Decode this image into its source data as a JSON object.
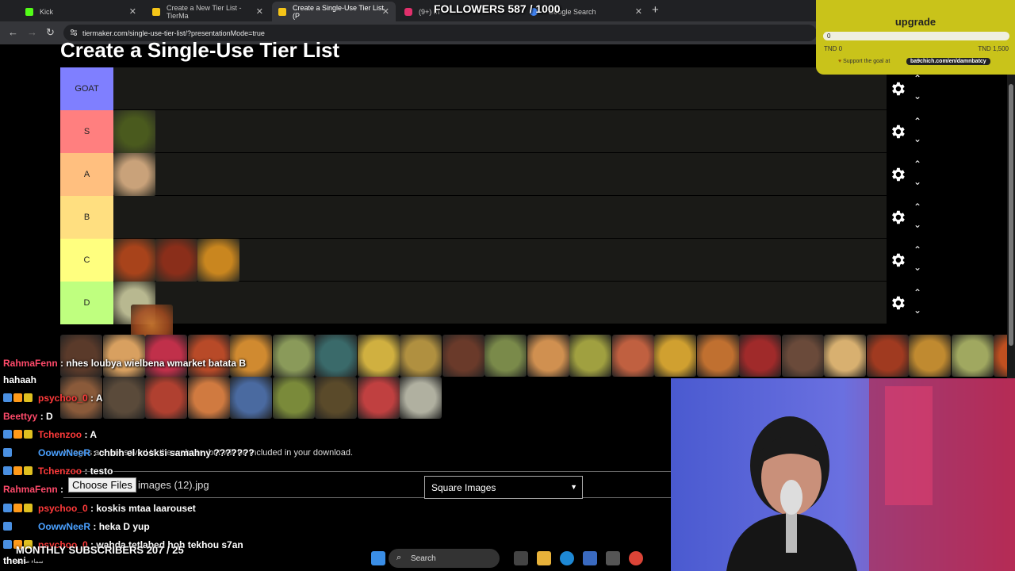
{
  "browser": {
    "tabs": [
      {
        "label": "Kick",
        "color": "#53fc18"
      },
      {
        "label": "Create a New Tier List - TierMa",
        "color": "#f5c518"
      },
      {
        "label": "Create a Single-Use Tier List (P",
        "color": "#f5c518"
      },
      {
        "label": "(9+) In",
        "color": "#e1306c"
      },
      {
        "label": "- Google Search",
        "color": "#4285f4"
      }
    ],
    "url": "tiermaker.com/single-use-tier-list/?presentationMode=true"
  },
  "page": {
    "title": "Create a Single-Use Tier List",
    "tiers": [
      {
        "label": "GOAT",
        "color": "#7f7fff",
        "items": []
      },
      {
        "label": "S",
        "color": "#ff7f7f",
        "items": [
          "#4a5a1e"
        ]
      },
      {
        "label": "A",
        "color": "#ffbf7f",
        "items": [
          "#c9a27a"
        ]
      },
      {
        "label": "B",
        "color": "#ffdf80",
        "items": []
      },
      {
        "label": "C",
        "color": "#ffff7f",
        "items": [
          "#a8431b",
          "#8a2e1a",
          "#c9861f"
        ]
      },
      {
        "label": "D",
        "color": "#bfff7f",
        "items": [
          "#b8b890"
        ]
      }
    ],
    "pool_row1": [
      "#5a3a2a",
      "#d8a060",
      "#c0304a",
      "#b84a28",
      "#d08a30",
      "#8a9a5a",
      "#3a6a6a",
      "#d0b040",
      "#b09040",
      "#6a3a2a",
      "#7a8a4a",
      "#d09050",
      "#a0a040",
      "#c06040",
      "#d0a030",
      "#c07030",
      "#a02a2a",
      "#6a4a3a",
      "#d8b070",
      "#a03a20",
      "#c08a30",
      "#a0a860",
      "#c05020"
    ],
    "pool_row2": [
      "#8a5a3a",
      "#5a4a3a",
      "#b04030",
      "#d07a40",
      "#4a6aa0",
      "#7a8a3a",
      "#5a4a2a",
      "#c04040",
      "#b0b0a0"
    ],
    "info_text": "Images are not saved to the website, but will be included in your download.",
    "choose_files": "Choose Files",
    "file_name": "images (12).jpg",
    "image_shape": "Square Images"
  },
  "overlay": {
    "followers": "FOLLOWERS 587 / 1000",
    "upgrade_title": "upgrade",
    "goal_value": "0",
    "goal_low": "TND 0",
    "goal_high": "TND 1,500",
    "support_text": "Support the goal at",
    "support_link": "ba9chich.com/en/damnbatcy",
    "subs": "MONTHLY SUBSCRIBERS 207 / 25",
    "subs_small": "سماء صافية"
  },
  "chat": [
    {
      "user": "RahmaFenn",
      "color": "#ff4a6a",
      "text": ": nhes loubya wielbena wmarket batata B",
      "badges": 0
    },
    {
      "user": "",
      "color": "#ffffff",
      "text": "hahaah",
      "badges": 0
    },
    {
      "user": "psychoo_0",
      "color": "#ff3a3a",
      "text": ": A",
      "badges": 3
    },
    {
      "user": "Beettyy",
      "color": "#ff4a6a",
      "text": ": D",
      "badges": 0
    },
    {
      "user": "Tchenzoo",
      "color": "#ff3a3a",
      "text": ": A",
      "badges": 3
    },
    {
      "user": "OowwNeeR",
      "color": "#4aa0ff",
      "text": ": chbih el kosksi samahny ???????",
      "badges": 1
    },
    {
      "user": "Tchenzoo",
      "color": "#ff3a3a",
      "text": ": testo",
      "badges": 3
    },
    {
      "user": "RahmaFenn",
      "color": "#ff4a6a",
      "text": ":",
      "badges": 0
    },
    {
      "user": "psychoo_0",
      "color": "#ff3a3a",
      "text": ": koskis mtaa laarouset",
      "badges": 3
    },
    {
      "user": "OowwNeeR",
      "color": "#4aa0ff",
      "text": ": heka D yup",
      "badges": 1
    },
    {
      "user": "psychoo_0",
      "color": "#ff3a3a",
      "text": ": wahda tetlabed hoh tekhou s7an",
      "badges": 3
    },
    {
      "user": "",
      "color": "#ffffff",
      "text": "theni",
      "badges": 0
    }
  ],
  "taskbar": {
    "search": "Search"
  }
}
